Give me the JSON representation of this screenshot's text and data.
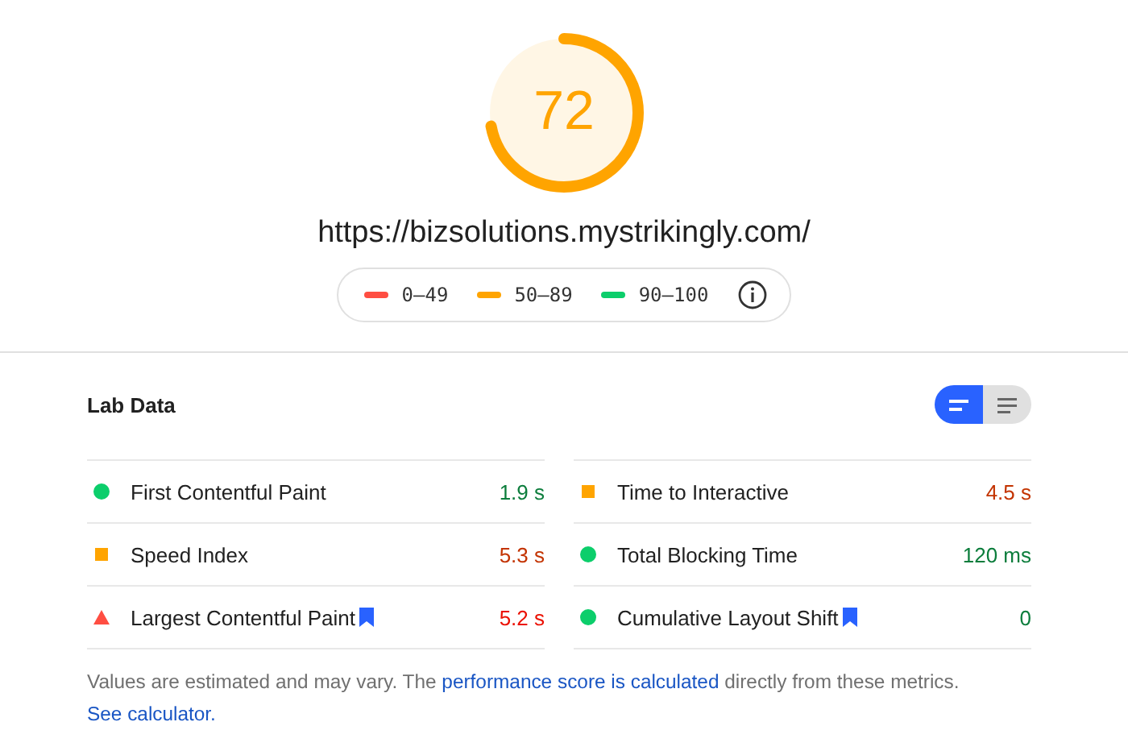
{
  "score": {
    "value": "72",
    "kind": "average"
  },
  "url": "https://bizsolutions.mystrikingly.com/",
  "legend": [
    {
      "kind": "fail",
      "label": "0–49"
    },
    {
      "kind": "average",
      "label": "50–89"
    },
    {
      "kind": "pass",
      "label": "90–100"
    }
  ],
  "section": {
    "title": "Lab Data"
  },
  "view_toggle": [
    {
      "kind": "bars",
      "selected": true
    },
    {
      "kind": "lines",
      "selected": false
    }
  ],
  "metrics": [
    {
      "name": "First Contentful Paint",
      "value": "1.9 s",
      "kind": "pass",
      "bookmarked": false
    },
    {
      "name": "Time to Interactive",
      "value": "4.5 s",
      "kind": "average",
      "bookmarked": false
    },
    {
      "name": "Speed Index",
      "value": "5.3 s",
      "kind": "average",
      "bookmarked": false
    },
    {
      "name": "Total Blocking Time",
      "value": "120 ms",
      "kind": "pass",
      "bookmarked": false
    },
    {
      "name": "Largest Contentful Paint",
      "value": "5.2 s",
      "kind": "fail",
      "bookmarked": true
    },
    {
      "name": "Cumulative Layout Shift",
      "value": "0",
      "kind": "pass",
      "bookmarked": true
    }
  ],
  "footnote": [
    {
      "text": "Values are estimated and may vary. The ",
      "link": false
    },
    {
      "text": "performance score is calculated",
      "link": true
    },
    {
      "text": " directly from these metrics. ",
      "link": false
    },
    {
      "text": "See calculator.",
      "link": true
    }
  ]
}
